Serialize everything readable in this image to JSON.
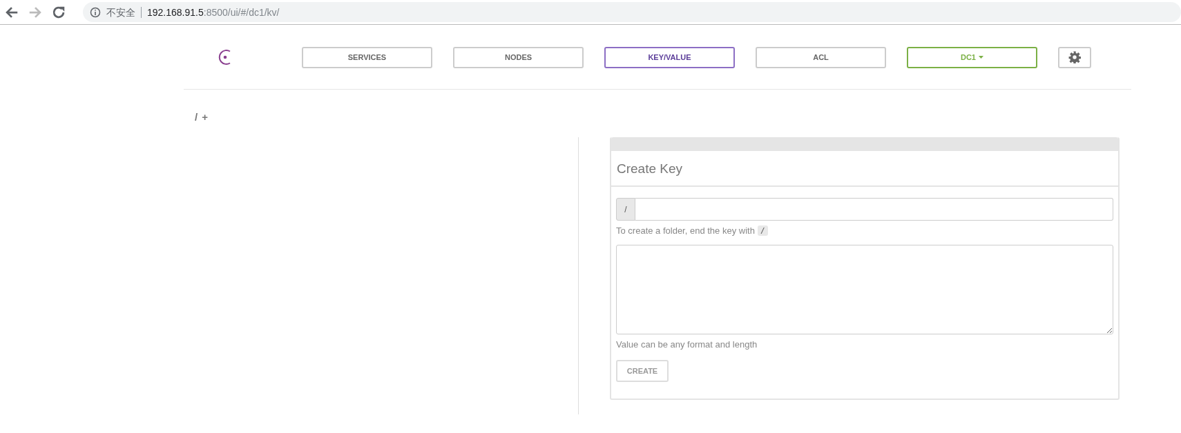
{
  "browser": {
    "security_label": "不安全",
    "url_host": "192.168.91.5",
    "url_path": ":8500/ui/#/dc1/kv/",
    "forward_disabled": true
  },
  "nav": [
    {
      "label": "SERVICES",
      "kind": "tab",
      "selected": false
    },
    {
      "label": "NODES",
      "kind": "tab",
      "selected": false
    },
    {
      "label": "KEY/VALUE",
      "kind": "tab",
      "selected": true
    },
    {
      "label": "ACL",
      "kind": "tab",
      "selected": false
    },
    {
      "label": "DC1",
      "kind": "dropdown"
    }
  ],
  "breadcrumb": {
    "path": "/",
    "add": "+"
  },
  "create_key": {
    "title": "Create Key",
    "key_prefix": "/",
    "key_hint": "To create a folder, end the key with",
    "key_hint_code": "/",
    "value_hint": "Value can be any format and length",
    "button": "CREATE"
  }
}
